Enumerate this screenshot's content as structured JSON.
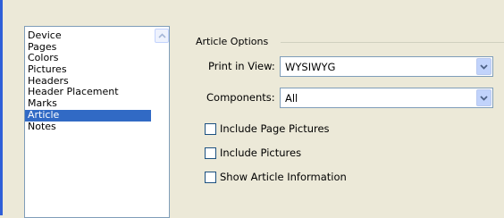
{
  "categories": {
    "items": [
      "Device",
      "Pages",
      "Colors",
      "Pictures",
      "Headers",
      "Header Placement",
      "Marks",
      "Article",
      "Notes"
    ],
    "selected": "Article"
  },
  "article_options": {
    "title": "Article Options",
    "print_in_view": {
      "label": "Print in View:",
      "value": "WYSIWYG"
    },
    "components": {
      "label": "Components:",
      "value": "All"
    },
    "checkboxes": [
      {
        "label": "Include Page Pictures",
        "checked": false
      },
      {
        "label": "Include Pictures",
        "checked": false
      },
      {
        "label": "Show Article Information",
        "checked": false
      }
    ]
  },
  "colors": {
    "selection": "#316ac5",
    "accent": "#2f5fd8",
    "dialog_bg": "#ece9d8"
  },
  "icons": {
    "list_scroll": "chevron-up-icon",
    "dropdown": "chevron-down-icon"
  }
}
